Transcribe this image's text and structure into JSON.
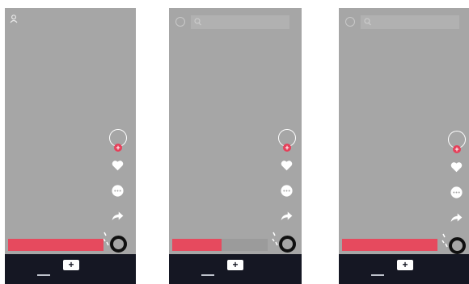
{
  "create_label": "+",
  "follow_label": "+",
  "phones": [
    {
      "progress": 1.0
    },
    {
      "progress": 0.52
    },
    {
      "progress": 1.0
    }
  ],
  "colors": {
    "video_bg": "#a6a6a6",
    "nav_bg": "#151723",
    "accent": "#e64a5e",
    "follow": "#e6405a"
  },
  "icons": [
    "user-icon",
    "circle-icon",
    "search-icon",
    "heart-icon",
    "comment-icon",
    "share-icon",
    "music-note-icon",
    "music-disc-icon",
    "create-plus-icon"
  ]
}
